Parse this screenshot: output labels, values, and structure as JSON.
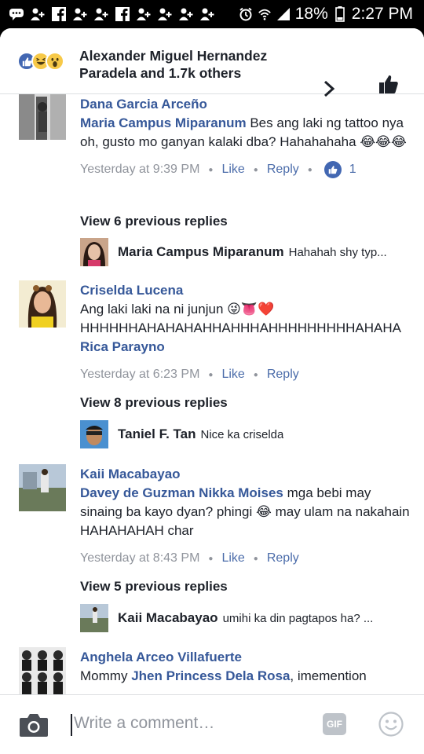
{
  "status_bar": {
    "battery_percent": "18%",
    "time": "2:27 PM",
    "icons": [
      "chat-icon",
      "person-add-icon",
      "facebook-icon",
      "person-add-icon",
      "person-add-icon",
      "facebook-icon",
      "person-add-icon",
      "person-add-icon",
      "person-add-icon",
      "person-add-icon",
      "alarm-icon",
      "wifi-icon",
      "signal-icon",
      "battery-icon"
    ]
  },
  "header": {
    "title": "Alexander Miguel Hernandez Paradela and 1.7k others",
    "reactions": [
      "like",
      "haha",
      "wow"
    ]
  },
  "comments": [
    {
      "author": "Dana Garcia Arceño",
      "tag": "Maria Campus Miparanum",
      "text": "Bes ang laki ng tattoo nya oh, gusto mo ganyan kalaki dba? Hahahahaha 😂😂😂",
      "time": "Yesterday at 9:39 PM",
      "like_label": "Like",
      "reply_label": "Reply",
      "like_count": "1",
      "view_previous": "View 6 previous replies",
      "last_reply": {
        "name": "Maria Campus Miparanum",
        "text": "Hahahah shy typ..."
      }
    },
    {
      "author": "Criselda Lucena",
      "text_line1": "Ang laki laki na ni junjun 😜👅❤️",
      "text_line2": "HHHHHHAHAHAHAHHAHHHAHHHHHHHHHAHAHA",
      "tag": "Rica Parayno",
      "time": "Yesterday at 6:23 PM",
      "like_label": "Like",
      "reply_label": "Reply",
      "view_previous": "View 8 previous replies",
      "last_reply": {
        "name": "Taniel F. Tan",
        "text": "Nice ka criselda"
      }
    },
    {
      "author": "Kaii Macabayao",
      "tag": "Davey de Guzman Nikka Moises",
      "text": "mga bebi may sinaing ba kayo dyan? phingi 😂 may ulam na nakahain HAHAHAHAH char",
      "time": "Yesterday at 8:43 PM",
      "like_label": "Like",
      "reply_label": "Reply",
      "view_previous": "View 5 previous replies",
      "last_reply": {
        "name": "Kaii Macabayao",
        "text": "umihi ka din pagtapos ha? ..."
      }
    },
    {
      "author": "Anghela Arceo Villafuerte",
      "text_prefix": "Mommy",
      "tag": "Jhen Princess Dela Rosa",
      "text_suffix": ", imemention"
    }
  ],
  "composer": {
    "placeholder": "Write a comment…",
    "gif_label": "GIF"
  },
  "colors": {
    "link": "#365899",
    "meta": "#90949c",
    "like_blue": "#4267b2"
  }
}
